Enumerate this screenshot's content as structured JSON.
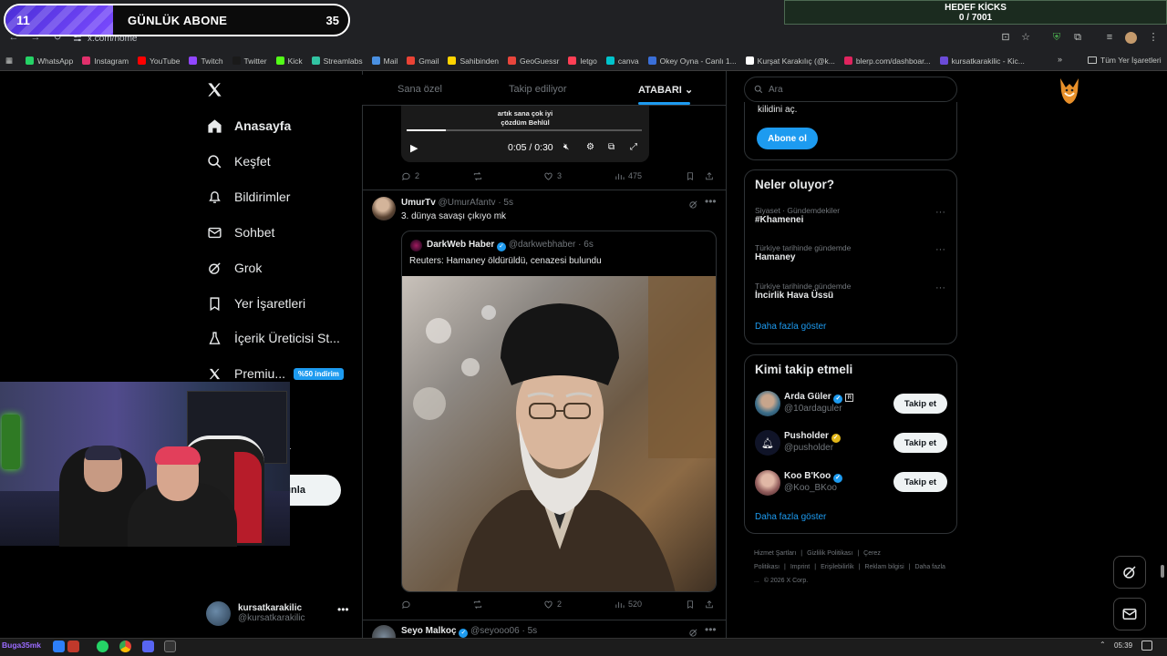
{
  "browser": {
    "url": "x.com/home",
    "bookmarks": [
      "WhatsApp",
      "Instagram",
      "YouTube",
      "Twitch",
      "Twitter",
      "Kick",
      "Streamlabs",
      "Mail",
      "Gmail",
      "Sahibinden",
      "GeoGuessr",
      "letgo",
      "canva",
      "Okey Oyna - Canlı 1...",
      "Kurşat Karakılıç (@k...",
      "blerp.com/dashboar...",
      "kursatkarakilic - Kic..."
    ],
    "bookmark_colors": [
      "#25d366",
      "#e1306c",
      "#ff0000",
      "#9146ff",
      "#1a1a1a",
      "#53fc18",
      "#31c3a2",
      "#4a90e2",
      "#ea4335",
      "#ffd400",
      "#e8453c",
      "#ff3f55",
      "#00c4cc",
      "#3a6fd8",
      "#ffffff",
      "#e0245e",
      "#6b4bd8"
    ],
    "all_bookmarks": "Tüm Yer İşaretleri"
  },
  "overlay": {
    "sub_current": "11",
    "sub_title": "GÜNLÜK ABONE",
    "sub_target": "35",
    "sub_progress": 0.314,
    "kicks_title": "HEDEF KİCKS",
    "kicks_value": "0 / 7001"
  },
  "nav": {
    "items": [
      {
        "label": "Anasayfa",
        "icon": "home-icon"
      },
      {
        "label": "Keşfet",
        "icon": "search-icon"
      },
      {
        "label": "Bildirimler",
        "icon": "bell-icon"
      },
      {
        "label": "Sohbet",
        "icon": "mail-icon"
      },
      {
        "label": "Grok",
        "icon": "grok-icon"
      },
      {
        "label": "Yer İşaretleri",
        "icon": "bookmark-icon"
      },
      {
        "label": "İçerik Üreticisi St...",
        "icon": "creator-icon"
      },
      {
        "label": "Premiu...",
        "icon": "x-icon"
      }
    ],
    "promo_badge": "%50 indirim",
    "post_button": "ınla",
    "account_name": "kursatkarakilic",
    "account_handle": "@kursatkarakilic",
    "hidden_partial": "a"
  },
  "tabs": {
    "special": "Sana özel",
    "following": "Takip ediliyor",
    "atabari": "ATABARI"
  },
  "video_post": {
    "caption_line1": "artık sana çok iyi",
    "caption_line2": "çözdüm Behlül",
    "time": "0:05 / 0:30",
    "progress": 0.167,
    "replies": "2",
    "likes": "3",
    "views": "475"
  },
  "post": {
    "author": "UmurTv",
    "handle": "@UmurAfantv",
    "time": "· 5s",
    "text": "3. dünya savaşı çıkıyo mk",
    "quote": {
      "author": "DarkWeb Haber",
      "handle": "@darkwebhaber",
      "time": "· 6s",
      "text": "Reuters: Hamaney öldürüldü, cenazesi bulundu"
    },
    "likes": "2",
    "views": "520"
  },
  "next_post": {
    "author": "Seyo Malkoç",
    "handle": "@seyooo06",
    "time": "· 5s"
  },
  "search": {
    "placeholder": "Ara"
  },
  "premium": {
    "text": "kilidini aç.",
    "button": "Abone ol"
  },
  "trends": {
    "title": "Neler oluyor?",
    "items": [
      {
        "category": "Siyaset · Gündemdekiler",
        "name": "#Khamenei"
      },
      {
        "category": "Türkiye tarihinde gündemde",
        "name": "Hamaney"
      },
      {
        "category": "Türkiye tarihinde gündemde",
        "name": "İncirlik Hava Üssü"
      }
    ],
    "show_more": "Daha fazla göster"
  },
  "who_to_follow": {
    "title": "Kimi takip etmeli",
    "users": [
      {
        "name": "Arda Güler",
        "handle": "@10ardaguler"
      },
      {
        "name": "Pusholder",
        "handle": "@pusholder"
      },
      {
        "name": "Koo B'Koo",
        "handle": "@Koo_BKoo"
      }
    ],
    "follow_label": "Takip et",
    "show_more": "Daha fazla göster"
  },
  "footer": {
    "links": [
      "Hizmet Şartları",
      "|",
      "Gizlilik Politikası",
      "|",
      "Çerez Politikası",
      "|",
      "Imprint",
      "|",
      "Erişilebilirlik",
      "|",
      "Reklam bilgisi",
      "|",
      "Daha fazla ...",
      "© 2026 X Corp."
    ]
  },
  "taskbar": {
    "stream_label": "Buga35mk",
    "clock": "05:39"
  }
}
